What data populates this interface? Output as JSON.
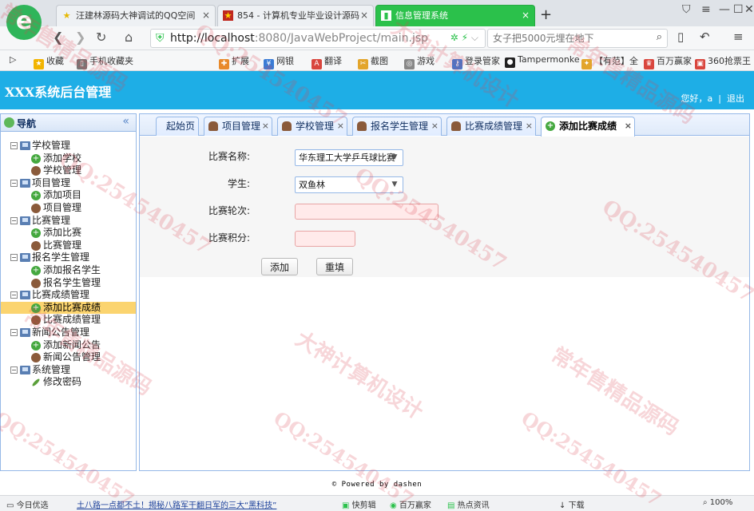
{
  "browser": {
    "tabs": [
      {
        "label": "汪建林源码大神调试的QQ空间"
      },
      {
        "label": "854 - 计算机专业毕业设计源码"
      },
      {
        "label": "信息管理系统"
      }
    ],
    "new_tab": "+",
    "url_host": "http://localhost",
    "url_rest": ":8080/JavaWebProject/main.jsp",
    "search_placeholder": "女子把5000元埋在地下",
    "bookmarks": [
      "收藏",
      "手机收藏夹",
      "扩展",
      "网银",
      "翻译",
      "截图",
      "游戏",
      "登录管家",
      "Tampermonke",
      "【有范】全",
      "百万赢家",
      "360抢票王"
    ]
  },
  "app": {
    "title": "XXX系统后台管理",
    "greeting": "您好，a",
    "separator": "|",
    "logout": "退出"
  },
  "sidebar": {
    "title": "导航",
    "collapse": "«",
    "groups": [
      {
        "label": "学校管理",
        "children": [
          "添加学校",
          "学校管理"
        ]
      },
      {
        "label": "项目管理",
        "children": [
          "添加项目",
          "项目管理"
        ]
      },
      {
        "label": "比赛管理",
        "children": [
          "添加比赛",
          "比赛管理"
        ]
      },
      {
        "label": "报名学生管理",
        "children": [
          "添加报名学生",
          "报名学生管理"
        ]
      },
      {
        "label": "比赛成绩管理",
        "children": [
          "添加比赛成绩",
          "比赛成绩管理"
        ]
      },
      {
        "label": "新闻公告管理",
        "children": [
          "添加新闻公告",
          "新闻公告管理"
        ]
      },
      {
        "label": "系统管理",
        "children": [
          "修改密码"
        ]
      }
    ]
  },
  "panel_tabs": [
    "起始页",
    "项目管理",
    "学校管理",
    "报名学生管理",
    "比赛成绩管理",
    "添加比赛成绩"
  ],
  "tab_close": "×",
  "form": {
    "match_label": "比赛名称:",
    "match_value": "华东理工大学乒乓球比赛",
    "student_label": "学生:",
    "student_value": "双鱼林",
    "round_label": "比赛轮次:",
    "round_value": "",
    "score_label": "比赛积分:",
    "score_value": "",
    "add_button": "添加",
    "reset_button": "重填"
  },
  "footer": "© Powered by dashen",
  "statusbar": [
    "今日优选",
    "土八路一点都不土！揭秘八路军干翻日军的三大“黑科技”",
    "快剪辑",
    "百万赢家",
    "热点资讯",
    "下载",
    "100%"
  ],
  "watermarks": [
    "常年售精品源码",
    "QQ:254540457",
    "大神计算机设计"
  ]
}
